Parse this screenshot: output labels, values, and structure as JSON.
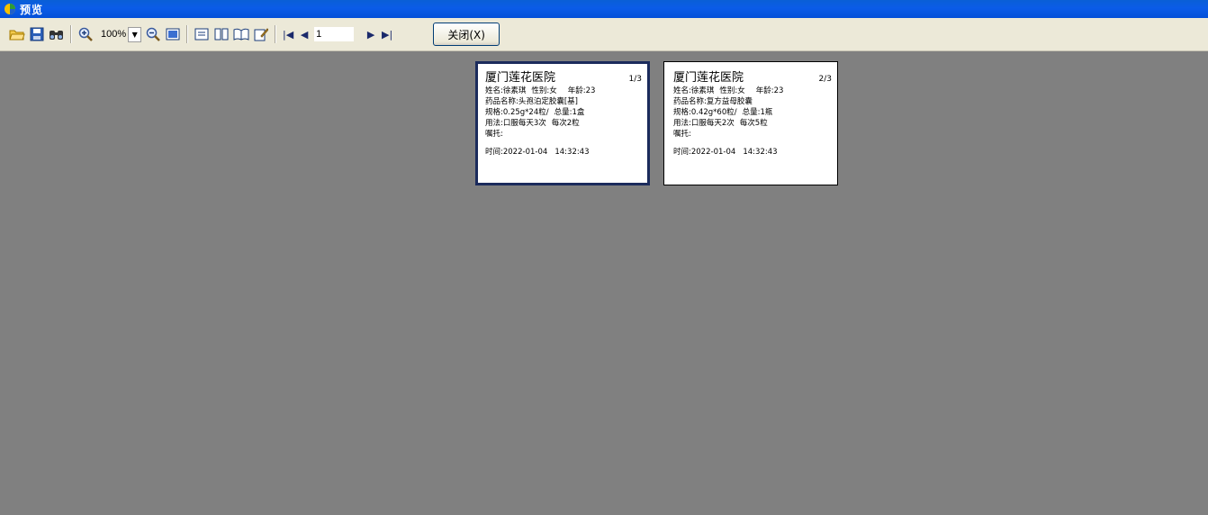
{
  "window": {
    "title": "预览"
  },
  "toolbar": {
    "icons": [
      "open-folder-icon",
      "save-icon",
      "find-icon",
      "zoom-in-icon",
      "zoom-out-icon",
      "full-page-icon",
      "one-page-icon",
      "two-page-icon",
      "open-book-icon",
      "edit-icon",
      "first-page-icon",
      "prev-page-icon",
      "next-page-icon",
      "last-page-icon"
    ],
    "zoom": "100%",
    "page_number": "1",
    "close_label": "关闭(X)"
  },
  "pages": [
    {
      "hospital": "厦门莲花医院",
      "page_num": "1/3",
      "name": "姓名:徐素琪",
      "gender": "性别:女",
      "age": "年龄:23",
      "drug": "药品名称:头孢泊定胶囊[基]",
      "spec": "规格:0.25g*24粒/",
      "total": "总量:1盒",
      "usage": "用法:口服每天3次",
      "dose": "每次2粒",
      "note": "嘱托:",
      "time": "时间:2022-01-04   14:32:43"
    },
    {
      "hospital": "厦门莲花医院",
      "page_num": "2/3",
      "name": "姓名:徐素琪",
      "gender": "性别:女",
      "age": "年龄:23",
      "drug": "药品名称:复方益母胶囊",
      "spec": "规格:0.42g*60粒/",
      "total": "总量:1瓶",
      "usage": "用法:口服每天2次",
      "dose": "每次5粒",
      "note": "嘱托:",
      "time": "时间:2022-01-04   14:32:43"
    }
  ],
  "colors": {
    "titlebar": "#0b5ce8",
    "toolbar": "#ece9d8",
    "workspace": "#808080",
    "selected_border": "#1b2b5c"
  }
}
